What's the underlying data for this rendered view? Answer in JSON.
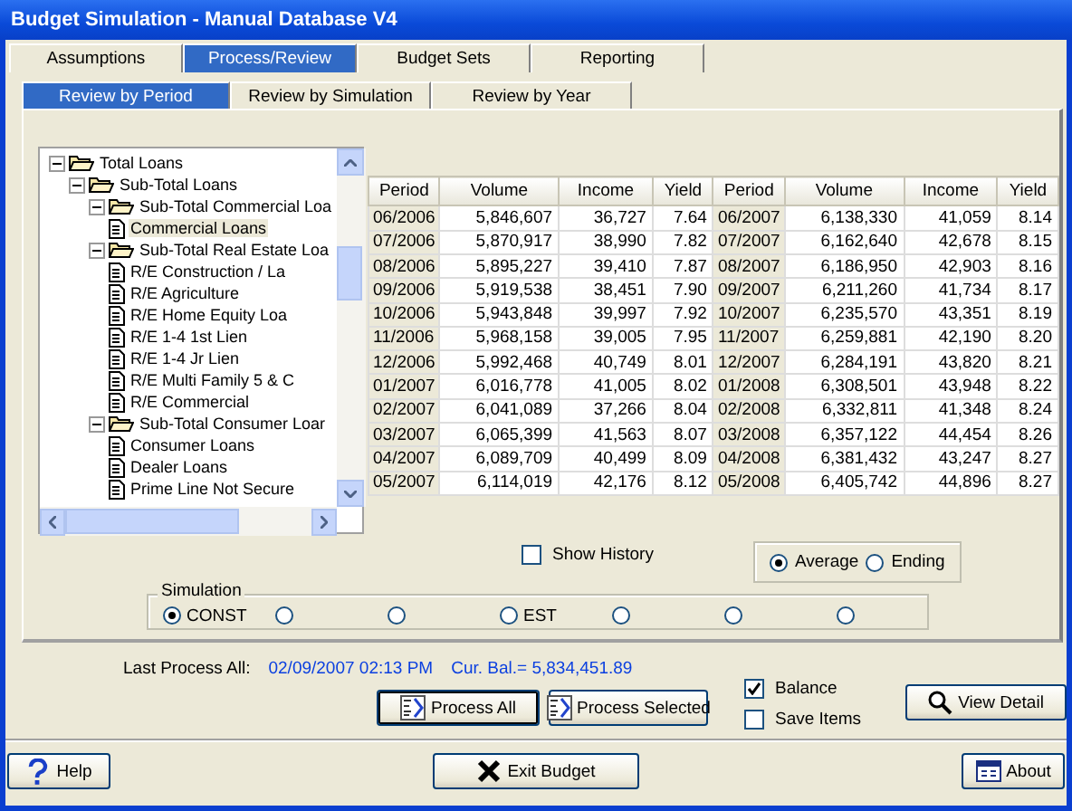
{
  "window": {
    "title": "Budget Simulation - Manual Database V4"
  },
  "tabs": [
    {
      "label": "Assumptions",
      "selected": false
    },
    {
      "label": "Process/Review",
      "selected": true
    },
    {
      "label": "Budget Sets",
      "selected": false
    },
    {
      "label": "Reporting",
      "selected": false
    }
  ],
  "subtabs": [
    {
      "label": "Review by Period",
      "selected": true
    },
    {
      "label": "Review by Simulation",
      "selected": false
    },
    {
      "label": "Review by Year",
      "selected": false
    }
  ],
  "tree": [
    {
      "label": "Total Loans",
      "kind": "folder",
      "expanded": true,
      "selected": false,
      "children": [
        {
          "label": "Sub-Total Loans",
          "kind": "folder",
          "expanded": true,
          "selected": false,
          "children": [
            {
              "label": "Sub-Total Commercial Loa",
              "kind": "folder",
              "expanded": true,
              "selected": false,
              "children": [
                {
                  "label": "Commercial Loans",
                  "kind": "item",
                  "selected": true
                }
              ]
            },
            {
              "label": "Sub-Total Real Estate Loa",
              "kind": "folder",
              "expanded": true,
              "selected": false,
              "children": [
                {
                  "label": "R/E Construction / La",
                  "kind": "item",
                  "selected": false
                },
                {
                  "label": "R/E Agriculture",
                  "kind": "item",
                  "selected": false
                },
                {
                  "label": "R/E Home Equity Loa",
                  "kind": "item",
                  "selected": false
                },
                {
                  "label": "R/E 1-4 1st Lien",
                  "kind": "item",
                  "selected": false
                },
                {
                  "label": "R/E 1-4 Jr Lien",
                  "kind": "item",
                  "selected": false
                },
                {
                  "label": "R/E Multi Family 5 & C",
                  "kind": "item",
                  "selected": false
                },
                {
                  "label": "R/E Commercial",
                  "kind": "item",
                  "selected": false
                }
              ]
            },
            {
              "label": "Sub-Total Consumer Loar",
              "kind": "folder",
              "expanded": true,
              "selected": false,
              "children": [
                {
                  "label": "Consumer Loans",
                  "kind": "item",
                  "selected": false
                },
                {
                  "label": "Dealer Loans",
                  "kind": "item",
                  "selected": false
                },
                {
                  "label": "Prime Line Not Secure",
                  "kind": "item",
                  "selected": false
                }
              ]
            }
          ]
        }
      ]
    }
  ],
  "table": {
    "columns": [
      "Period",
      "Volume",
      "Income",
      "Yield",
      "Period",
      "Volume",
      "Income",
      "Yield"
    ],
    "rows": [
      [
        "06/2006",
        "5,846,607",
        "36,727",
        "7.64",
        "06/2007",
        "6,138,330",
        "41,059",
        "8.14"
      ],
      [
        "07/2006",
        "5,870,917",
        "38,990",
        "7.82",
        "07/2007",
        "6,162,640",
        "42,678",
        "8.15"
      ],
      [
        "08/2006",
        "5,895,227",
        "39,410",
        "7.87",
        "08/2007",
        "6,186,950",
        "42,903",
        "8.16"
      ],
      [
        "09/2006",
        "5,919,538",
        "38,451",
        "7.90",
        "09/2007",
        "6,211,260",
        "41,734",
        "8.17"
      ],
      [
        "10/2006",
        "5,943,848",
        "39,997",
        "7.92",
        "10/2007",
        "6,235,570",
        "43,351",
        "8.19"
      ],
      [
        "11/2006",
        "5,968,158",
        "39,005",
        "7.95",
        "11/2007",
        "6,259,881",
        "42,190",
        "8.20"
      ],
      [
        "12/2006",
        "5,992,468",
        "40,749",
        "8.01",
        "12/2007",
        "6,284,191",
        "43,820",
        "8.21"
      ],
      [
        "01/2007",
        "6,016,778",
        "41,005",
        "8.02",
        "01/2008",
        "6,308,501",
        "43,948",
        "8.22"
      ],
      [
        "02/2007",
        "6,041,089",
        "37,266",
        "8.04",
        "02/2008",
        "6,332,811",
        "41,348",
        "8.24"
      ],
      [
        "03/2007",
        "6,065,399",
        "41,563",
        "8.07",
        "03/2008",
        "6,357,122",
        "44,454",
        "8.26"
      ],
      [
        "04/2007",
        "6,089,709",
        "40,499",
        "8.09",
        "04/2008",
        "6,381,432",
        "43,247",
        "8.27"
      ],
      [
        "05/2007",
        "6,114,019",
        "42,176",
        "8.12",
        "05/2008",
        "6,405,742",
        "44,896",
        "8.27"
      ]
    ]
  },
  "show_history": {
    "label": "Show History",
    "checked": false
  },
  "balance_mode": [
    {
      "label": "Average",
      "selected": true
    },
    {
      "label": "Ending",
      "selected": false
    }
  ],
  "simulation": {
    "title": "Simulation",
    "options": [
      {
        "label": "CONST",
        "selected": true
      },
      {
        "selected": false
      },
      {
        "selected": false
      },
      {
        "label": "EST",
        "selected": false
      },
      {
        "selected": false
      },
      {
        "selected": false
      },
      {
        "selected": false
      }
    ]
  },
  "status": {
    "label": "Last Process All:",
    "date": "02/09/2007 02:13 PM",
    "balance": "Cur. Bal.= 5,834,451.89"
  },
  "process_buttons": [
    {
      "label": "Process All",
      "default": true
    },
    {
      "label": "Process Selected",
      "default": false
    }
  ],
  "options": [
    {
      "label": "Balance",
      "checked": true
    },
    {
      "label": "Save Items",
      "checked": false
    }
  ],
  "view_detail": {
    "label": "View Detail"
  },
  "footer_buttons": [
    {
      "label": "Help",
      "kind": "help"
    },
    {
      "label": "Exit Budget",
      "kind": "exit"
    },
    {
      "label": "About",
      "kind": "about"
    }
  ]
}
